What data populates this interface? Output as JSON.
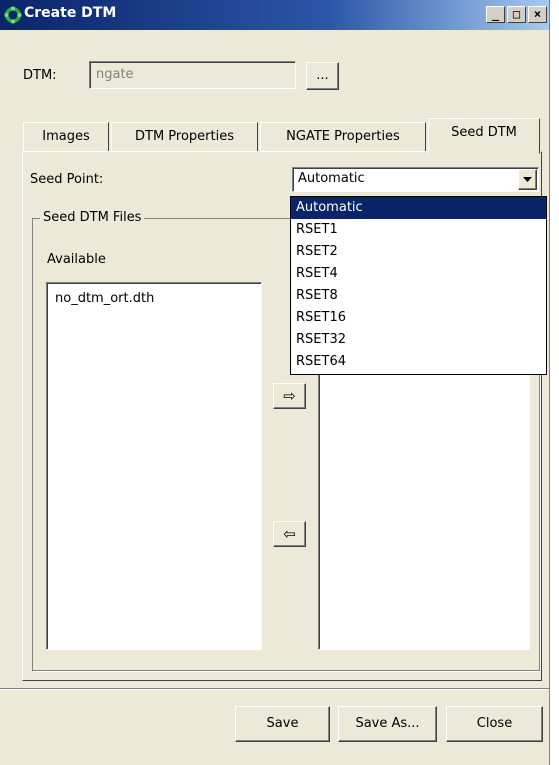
{
  "window": {
    "title": "Create DTM",
    "accent": "#0a246a"
  },
  "title_buttons": [
    "_",
    "□",
    "×"
  ],
  "dtm": {
    "label": "DTM:",
    "value": "ngate",
    "browse_label": "..."
  },
  "tabs": [
    {
      "label": "Images"
    },
    {
      "label": "DTM Properties"
    },
    {
      "label": "NGATE Properties"
    },
    {
      "label": "Seed DTM"
    }
  ],
  "seed_point": {
    "label": "Seed Point:",
    "selected": "Automatic",
    "options": [
      "Automatic",
      "RSET1",
      "RSET2",
      "RSET4",
      "RSET8",
      "RSET16",
      "RSET32",
      "RSET64"
    ]
  },
  "seed_files": {
    "group_label": "Seed DTM Files",
    "available_label": "Available",
    "available_items": [
      "no_dtm_ort.dth"
    ],
    "add_icon": "⇨",
    "remove_icon": "⇦"
  },
  "footer": {
    "save_label": "Save",
    "save_as_label": "Save As...",
    "close_label": "Close"
  }
}
